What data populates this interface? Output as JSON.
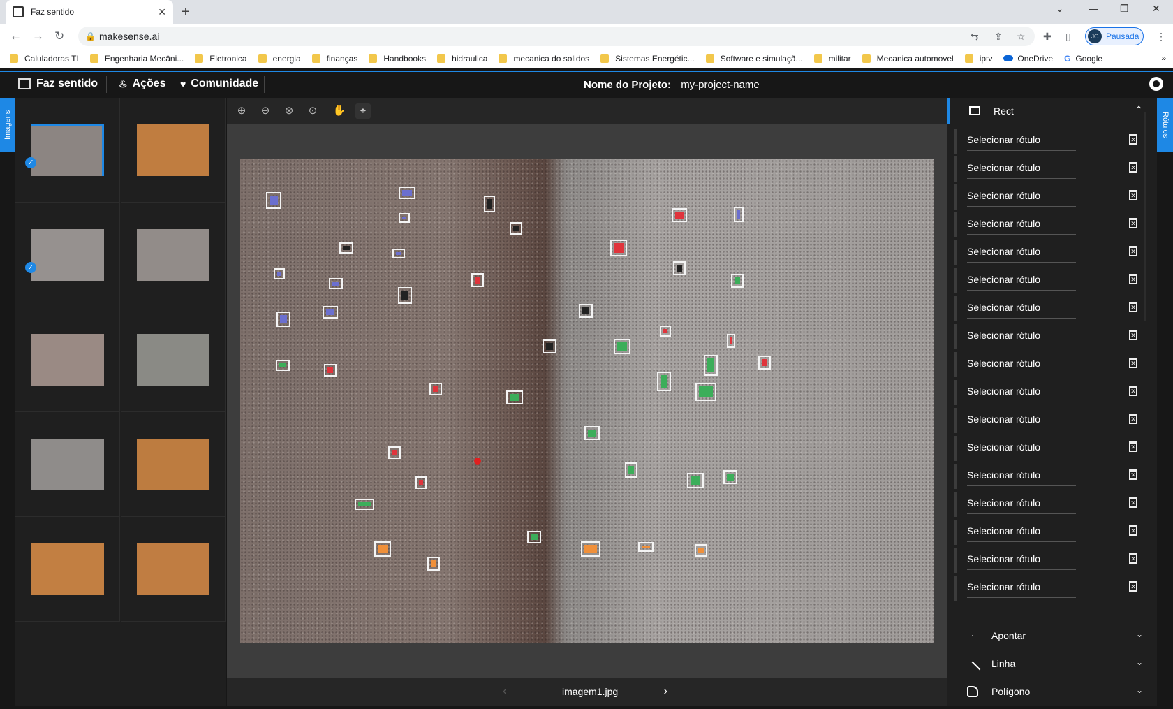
{
  "browser": {
    "tab_title": "Faz sentido",
    "url": "makesense.ai",
    "profile_label": "Pausada",
    "profile_initials": "JC",
    "bookmarks": [
      "Caluladoras TI",
      "Engenharia Mecâni...",
      "Eletronica",
      "energia",
      "finanças",
      "Handbooks",
      "hidraulica",
      "mecanica do solidos",
      "Sistemas Energétic...",
      "Software e simulaçã...",
      "militar",
      "Mecanica automovel",
      "iptv",
      "OneDrive",
      "Google"
    ],
    "bookmarks_more": "»"
  },
  "app": {
    "brand": "Faz sentido",
    "nav_actions": "Ações",
    "nav_community": "Comunidade",
    "project_label": "Nome do Projeto:",
    "project_name": "my-project-name"
  },
  "left_panel": {
    "tab_label": "Imagens"
  },
  "editor": {
    "filename": "imagem1.jpg"
  },
  "right_panel": {
    "tab_label": "Rótulos",
    "rect_title": "Rect",
    "label_placeholder": "Selecionar rótulo",
    "label_rows": 17,
    "tools": [
      {
        "label": "Apontar"
      },
      {
        "label": "Linha"
      },
      {
        "label": "Polígono"
      }
    ]
  },
  "colors": {
    "accent": "#1e88e5",
    "background": "#171717",
    "panel": "#1f1f1f",
    "annotation_blue": "#6b6fcf",
    "annotation_red": "#e0343c",
    "annotation_green": "#3cae5a",
    "annotation_black": "#222222",
    "annotation_orange": "#f0903a"
  }
}
